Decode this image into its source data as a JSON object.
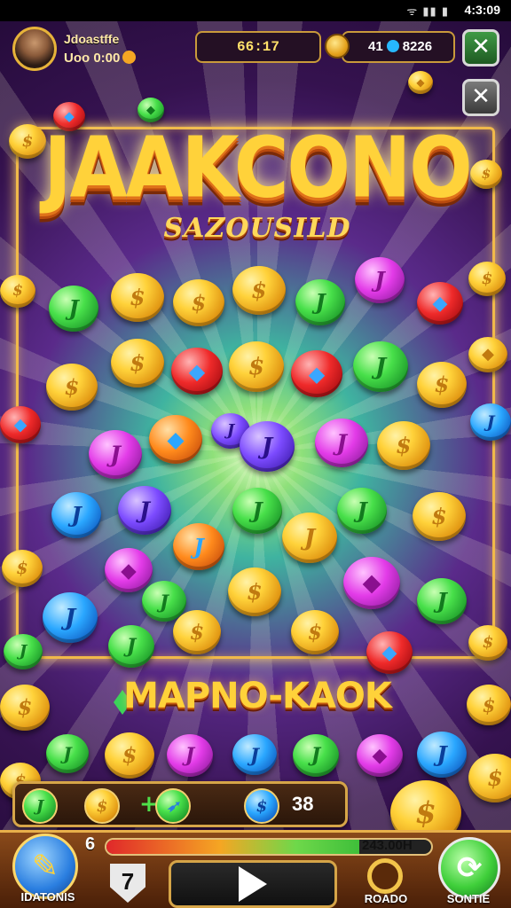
{
  "status_bar": {
    "signal": "ᯤ ▮▮ ▮",
    "time": "4:3:09"
  },
  "player": {
    "name": "Jdoastffe",
    "coins": "Uoo 0:00"
  },
  "header": {
    "timer": "66:17",
    "balance_left": "41",
    "balance_right": "8226",
    "close_label": "✕"
  },
  "title": {
    "main": "JAAKCONO",
    "sub": "SAZOUSILD"
  },
  "banner": "MAPNO-KAOK",
  "collect_panel": {
    "slot1": "J",
    "slot2": "$",
    "slot4": "$",
    "count": "38"
  },
  "progress": {
    "left_label": "6",
    "value_text": "243.00H",
    "fill_percent": 0.78
  },
  "buttons": {
    "left_label": "IDATONIS",
    "arrow_label": "7",
    "ring_label": "ROADO",
    "right_label": "SONTIE"
  },
  "colors": {
    "gold": "#ffd23a",
    "frame": "#f0b94a",
    "green": "#48e04a",
    "bg": "#35124f"
  },
  "icons": [
    "avatar",
    "coin-icon",
    "gem-icon",
    "close-icon",
    "play-icon",
    "pencil-icon",
    "refresh-icon",
    "ring-icon"
  ]
}
